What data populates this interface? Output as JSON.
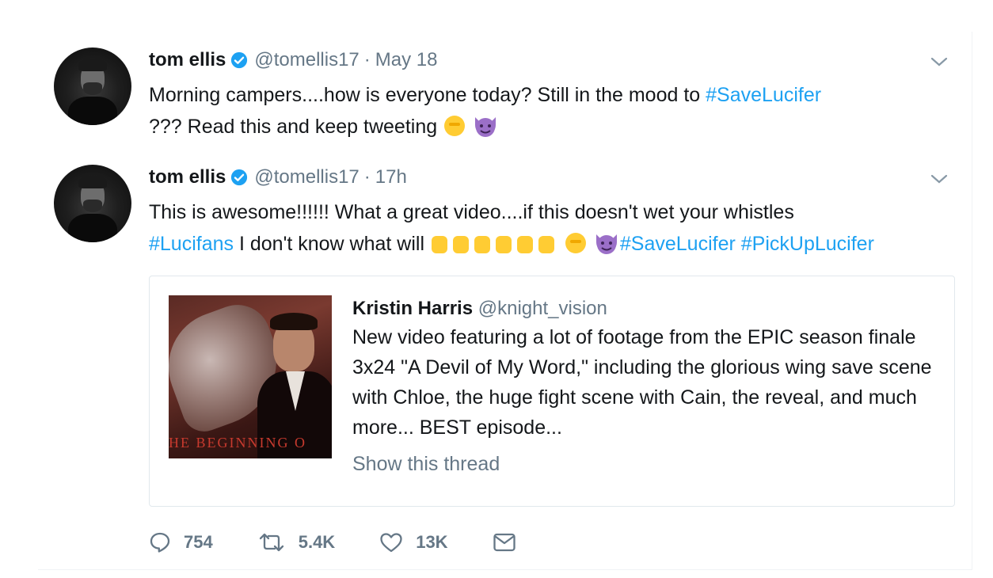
{
  "tweets": [
    {
      "name": "tom ellis",
      "handle": "@tomellis17",
      "separator": "·",
      "time": "May 18",
      "text_parts": {
        "t1": "Morning campers....how is everyone today? Still in the mood to ",
        "h1": "#SaveLucifer",
        "t2": "??? Read this and keep tweeting "
      },
      "emojis": [
        "fist-emoji",
        "smiling-imp-emoji"
      ]
    },
    {
      "name": "tom ellis",
      "handle": "@tomellis17",
      "separator": "·",
      "time": "17h",
      "text_parts": {
        "t1": "This is awesome!!!!!! What a great video....if this doesn't wet your whistles ",
        "h1": "#Lucifans",
        "t2": " I don't know what will ",
        "h2": "#SaveLucifer",
        "h3": "#PickUpLucifer"
      },
      "emojis": [
        "raised-hands-emoji x6",
        "fist-emoji",
        "smiling-imp-emoji"
      ],
      "quoted": {
        "name": "Kristin Harris",
        "handle": "@knight_vision",
        "text": "New video featuring a lot of footage from the EPIC season finale 3x24 \"A Devil of My Word,\" including the glorious wing save scene with Chloe, the huge fight scene with Cain, the reveal, and much more... BEST episode...",
        "thumbnail_caption": "HE BEGINNING O",
        "thread_link": "Show this thread"
      },
      "actions": {
        "replies": "754",
        "retweets": "5.4K",
        "likes": "13K"
      }
    }
  ],
  "icons": [
    "verified-icon",
    "caret-down-icon",
    "reply-icon",
    "retweet-icon",
    "like-icon",
    "message-icon"
  ],
  "colors": {
    "link": "#1da1f2",
    "secondary_text": "#657786",
    "verified": "#1da1f2"
  }
}
